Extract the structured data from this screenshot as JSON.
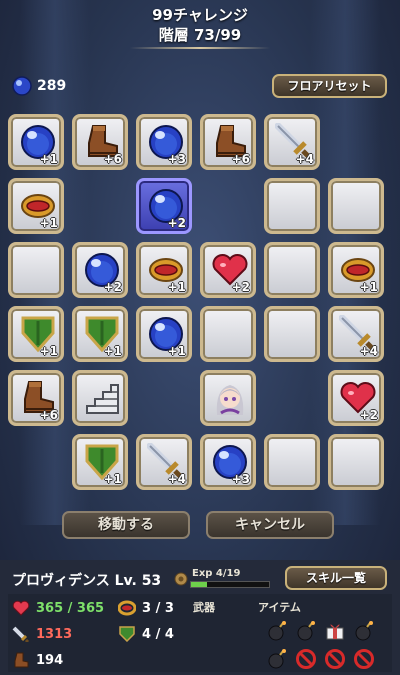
{
  "header": {
    "title": "99チャレンジ",
    "floor": "階層 73/99"
  },
  "orbs": {
    "count": "289"
  },
  "buttons": {
    "floor_reset": "フロアリセット",
    "move": "移動する",
    "cancel": "キャンセル",
    "skill_list": "スキル一覧"
  },
  "grid": {
    "r0": [
      {
        "item": "orb",
        "count": "+1"
      },
      {
        "item": "boots",
        "count": "+6"
      },
      {
        "item": "orb",
        "count": "+3"
      },
      {
        "item": "boots",
        "count": "+6"
      },
      {
        "item": "sword",
        "count": "+4"
      },
      {
        "item": "none"
      }
    ],
    "r1": [
      {
        "item": "ring",
        "count": "+1"
      },
      {
        "item": "none"
      },
      {
        "item": "orb",
        "count": "+2",
        "selected": true
      },
      {
        "item": "none"
      },
      {
        "item": "empty"
      },
      {
        "item": "empty"
      }
    ],
    "r2": [
      {
        "item": "empty"
      },
      {
        "item": "orb",
        "count": "+2"
      },
      {
        "item": "ring",
        "count": "+1"
      },
      {
        "item": "heart",
        "count": "+2"
      },
      {
        "item": "empty"
      },
      {
        "item": "ring",
        "count": "+1"
      }
    ],
    "r3": [
      {
        "item": "shield",
        "count": "+1"
      },
      {
        "item": "shield",
        "count": "+1"
      },
      {
        "item": "orb",
        "count": "+1"
      },
      {
        "item": "empty"
      },
      {
        "item": "empty"
      },
      {
        "item": "sword",
        "count": "+4"
      }
    ],
    "r4": [
      {
        "item": "boots",
        "count": "+6"
      },
      {
        "item": "stairs"
      },
      {
        "item": "none"
      },
      {
        "item": "hero"
      },
      {
        "item": "none"
      },
      {
        "item": "heart",
        "count": "+2"
      }
    ],
    "r5": [
      {
        "item": "none"
      },
      {
        "item": "shield",
        "count": "+1"
      },
      {
        "item": "sword",
        "count": "+4"
      },
      {
        "item": "orb",
        "count": "+3"
      },
      {
        "item": "empty"
      },
      {
        "item": "empty"
      }
    ]
  },
  "character": {
    "name": "プロヴィデンス Lv. 53",
    "exp": "Exp 4/19",
    "exp_fraction": 0.21
  },
  "stats": {
    "hp": "365 / 365",
    "rings": "3 / 3",
    "attack": "1313",
    "shields": "4 / 4",
    "speed": "194"
  },
  "sections": {
    "weapon": "武器",
    "items": "アイテム"
  },
  "inventory": [
    "bomb",
    "bomb",
    "gift",
    "bomb",
    "bomb",
    "blocked",
    "blocked",
    "blocked"
  ],
  "colors": {
    "hp_green": "#7ee06a",
    "attack_red": "#ff6a5c",
    "gold_border": "#c9b27a"
  }
}
